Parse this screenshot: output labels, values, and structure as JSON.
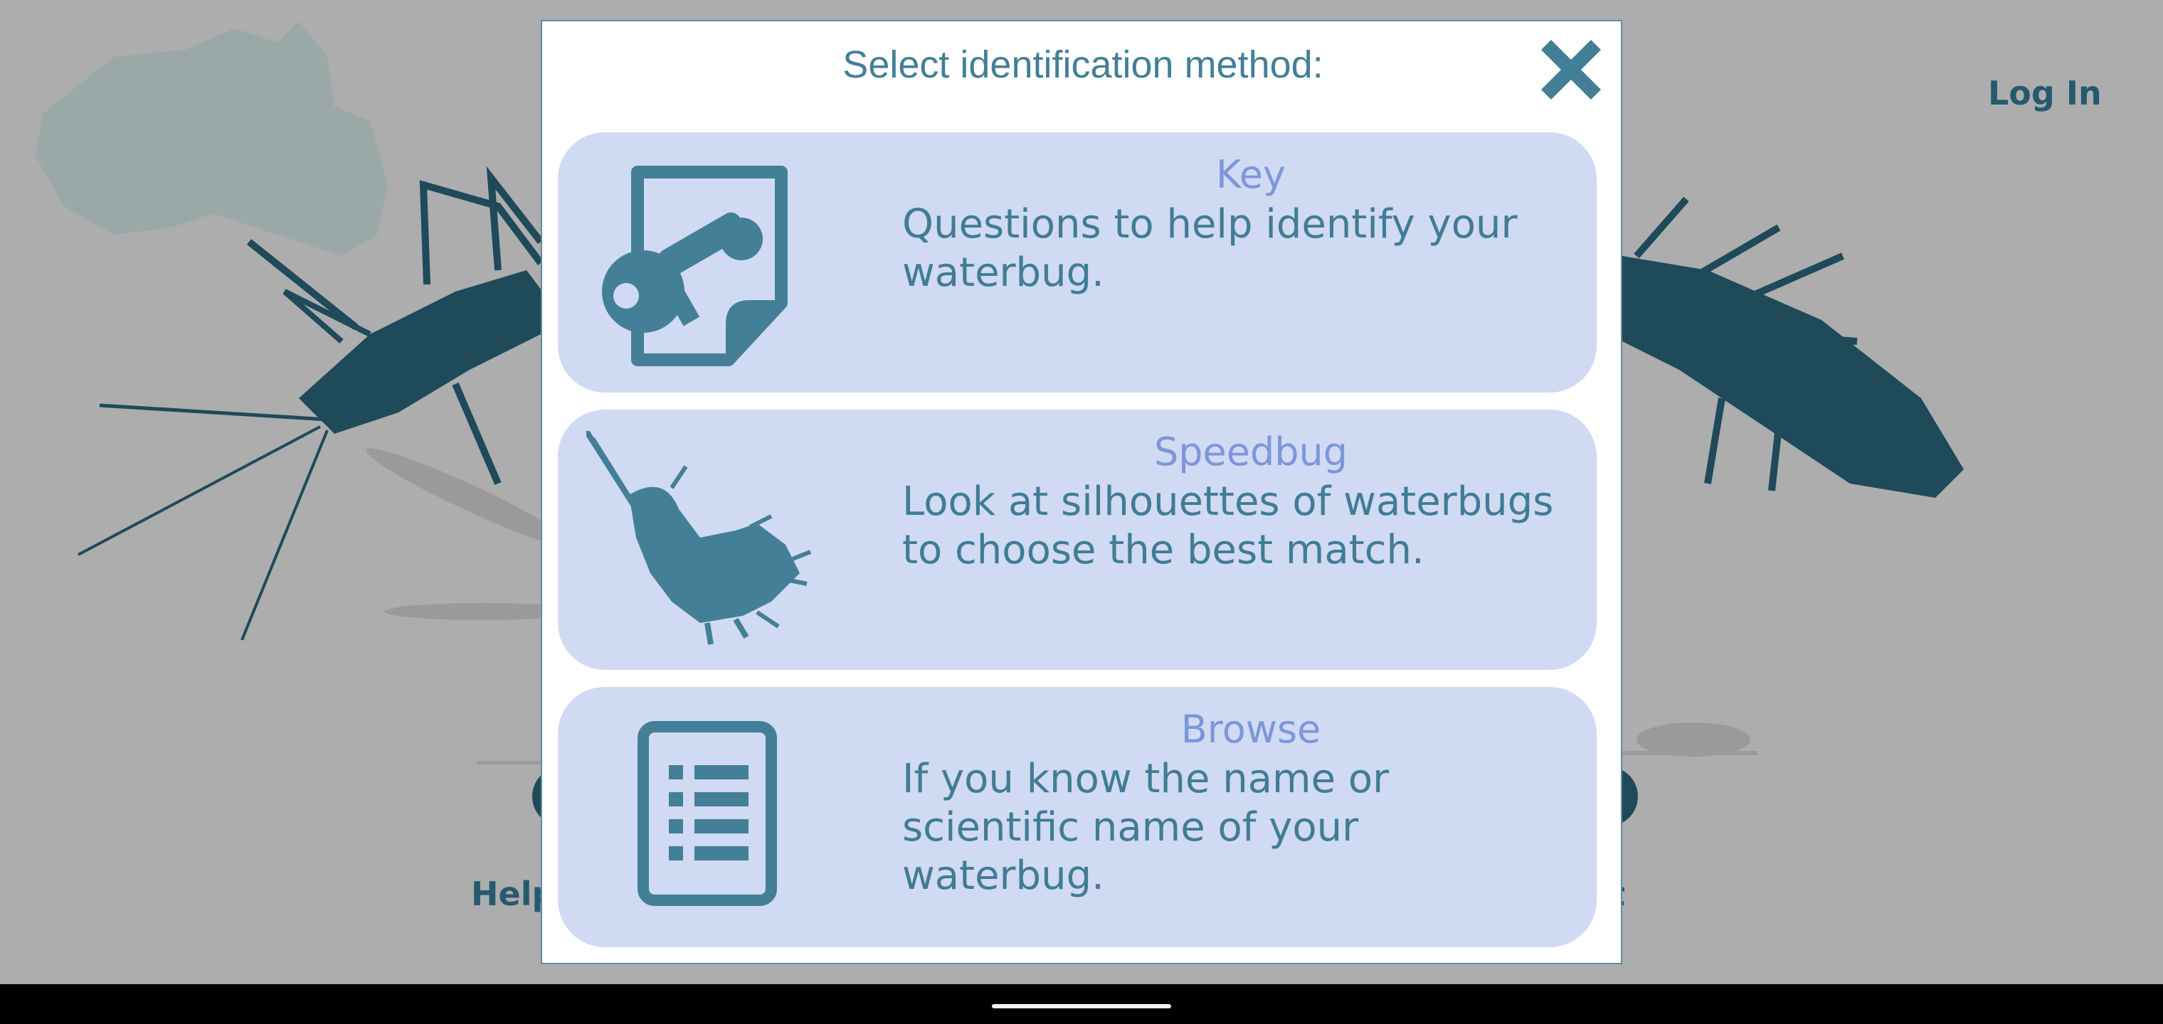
{
  "background": {
    "login_label": "Log In",
    "help_label_partial": "Help",
    "right_label_partial": "t"
  },
  "modal": {
    "title": "Select identification method:",
    "close_icon": "close-icon",
    "options": [
      {
        "title": "Key",
        "description": "Questions to help identify your waterbug.",
        "icon": "key-document-icon"
      },
      {
        "title": "Speedbug",
        "description": "Look at silhouettes of waterbugs to choose the best match.",
        "icon": "waterbug-silhouette-icon"
      },
      {
        "title": "Browse",
        "description": "If you know the name or scientific name of your waterbug.",
        "icon": "list-icon"
      }
    ]
  },
  "colors": {
    "modal_text": "#437f96",
    "option_bg": "#d0daf2",
    "option_title": "#7d96da",
    "icon": "#437f96",
    "background": "#adadad",
    "silhouette": "#1e4a5a"
  }
}
